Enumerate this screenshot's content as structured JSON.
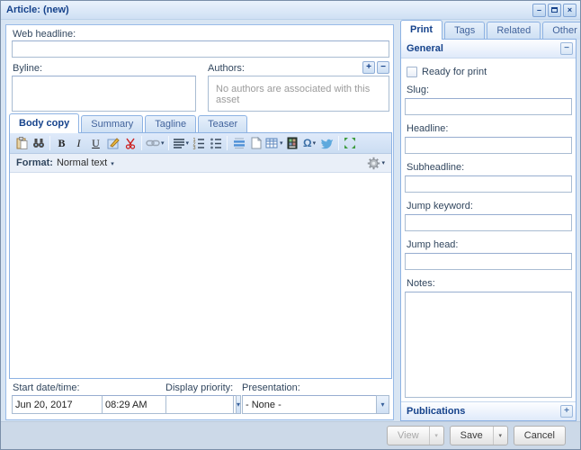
{
  "window": {
    "title": "Article: (new)"
  },
  "icons": {
    "minimize": "–",
    "close": "×",
    "dropdown": "▾",
    "plus": "+",
    "minus": "−",
    "bold": "B",
    "italic": "I",
    "underline": "U",
    "special_character": "Ω"
  },
  "left": {
    "web_headline": {
      "label": "Web headline:",
      "value": ""
    },
    "byline": {
      "label": "Byline:",
      "value": ""
    },
    "authors": {
      "label": "Authors:",
      "empty_text": "No authors are associated with this asset"
    },
    "editor_tabs": [
      {
        "label": "Body copy",
        "active": true
      },
      {
        "label": "Summary",
        "active": false
      },
      {
        "label": "Tagline",
        "active": false
      },
      {
        "label": "Teaser",
        "active": false
      }
    ],
    "toolbar_icons": [
      "paste",
      "find",
      "bold",
      "italic",
      "underline",
      "annotate",
      "cut",
      "link",
      "alignment",
      "ordered-list",
      "unordered-list",
      "divider",
      "page-break",
      "table",
      "media",
      "special-character",
      "twitter",
      "fullscreen",
      "format-gear"
    ],
    "format": {
      "label": "Format:",
      "value": "Normal text"
    },
    "start_datetime": {
      "label": "Start date/time:",
      "date": "Jun 20, 2017",
      "time": "08:29 AM"
    },
    "display_priority": {
      "label": "Display priority:",
      "value": ""
    },
    "presentation": {
      "label": "Presentation:",
      "value": "- None -"
    }
  },
  "right": {
    "tabs": [
      {
        "label": "Print",
        "active": true
      },
      {
        "label": "Tags",
        "active": false
      },
      {
        "label": "Related",
        "active": false
      },
      {
        "label": "Other",
        "active": false
      }
    ],
    "general": {
      "title": "General",
      "ready_for_print_label": "Ready for print",
      "fields": [
        {
          "label": "Slug:",
          "value": ""
        },
        {
          "label": "Headline:",
          "value": ""
        },
        {
          "label": "Subheadline:",
          "value": ""
        },
        {
          "label": "Jump keyword:",
          "value": ""
        },
        {
          "label": "Jump head:",
          "value": ""
        },
        {
          "label": "Notes:",
          "value": ""
        }
      ]
    },
    "publications": {
      "title": "Publications"
    }
  },
  "footer": {
    "view_label": "View",
    "save_label": "Save",
    "cancel_label": "Cancel"
  },
  "colors": {
    "accent": "#15428b",
    "panel_border": "#99bbe8",
    "tab_text": "#416aa3",
    "required_underline": "#cc3333",
    "footer_bg": "#ccd9e8"
  }
}
